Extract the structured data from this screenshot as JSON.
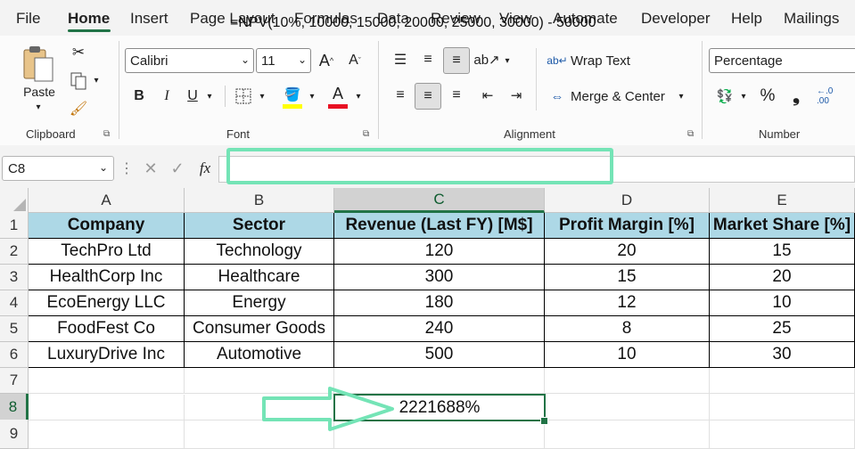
{
  "menu": [
    "File",
    "Home",
    "Insert",
    "Page Layout",
    "Formulas",
    "Data",
    "Review",
    "View",
    "Automate",
    "Developer",
    "Help",
    "Mailings"
  ],
  "ribbon": {
    "clipboard": {
      "paste_label": "Paste",
      "group_label": "Clipboard"
    },
    "font": {
      "font_name": "Calibri",
      "font_size": "11",
      "group_label": "Font",
      "highlight_color": "#ffff00",
      "font_color": "#e81123"
    },
    "alignment": {
      "wrap_text": "Wrap Text",
      "merge_center": "Merge & Center",
      "group_label": "Alignment"
    },
    "number": {
      "format": "Percentage",
      "group_label": "Number"
    }
  },
  "formula_bar": {
    "name_box": "C8",
    "fx": "fx",
    "formula": "=NPV(10%, 10000, 15000, 20000, 25000, 30000) - 50000"
  },
  "sheet": {
    "columns": [
      "A",
      "B",
      "C",
      "D",
      "E"
    ],
    "rows": [
      "1",
      "2",
      "3",
      "4",
      "5",
      "6",
      "7",
      "8",
      "9"
    ],
    "header": [
      "Company",
      "Sector",
      "Revenue (Last FY) [M$]",
      "Profit Margin [%]",
      "Market Share [%]"
    ],
    "data": [
      [
        "TechPro Ltd",
        "Technology",
        "120",
        "20",
        "15"
      ],
      [
        "HealthCorp Inc",
        "Healthcare",
        "300",
        "15",
        "20"
      ],
      [
        "EcoEnergy LLC",
        "Energy",
        "180",
        "12",
        "10"
      ],
      [
        "FoodFest Co",
        "Consumer Goods",
        "240",
        "8",
        "25"
      ],
      [
        "LuxuryDrive Inc",
        "Automotive",
        "500",
        "10",
        "30"
      ]
    ],
    "result_cell": "2221688%",
    "header_fill": "#add8e6",
    "accent": "#217346",
    "annotation_color": "#74e4b6"
  }
}
